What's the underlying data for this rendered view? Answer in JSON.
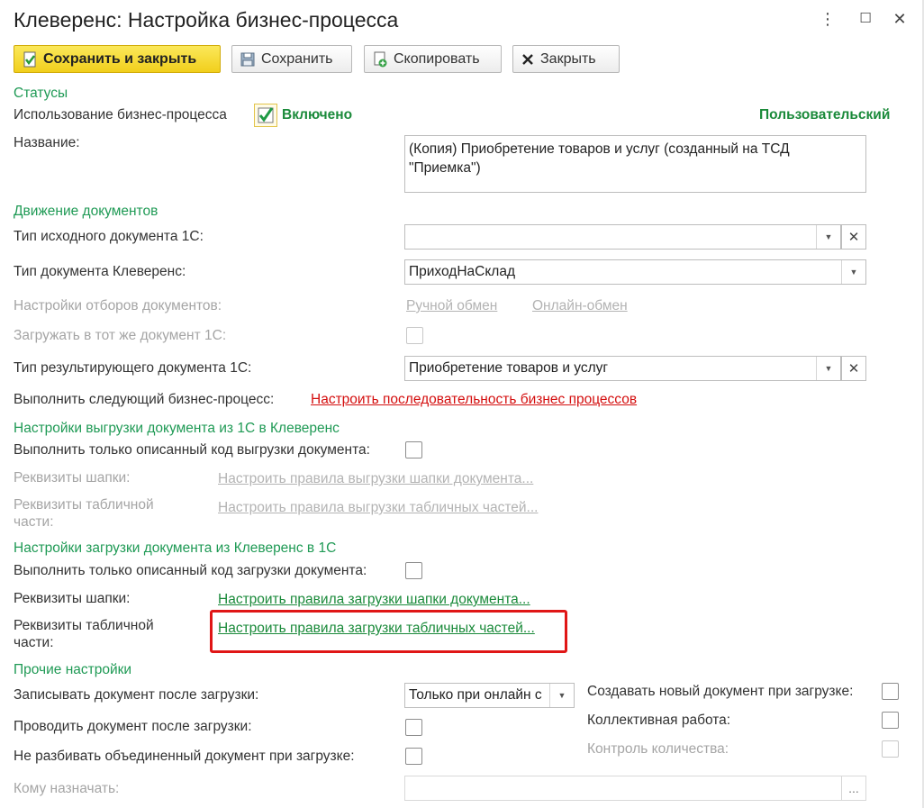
{
  "window": {
    "title": "Клеверенс: Настройка бизнес-процесса",
    "menu_glyph": "⋮",
    "maximize_glyph": "☐",
    "close_glyph": "✕"
  },
  "toolbar": {
    "save_close": "Сохранить и закрыть",
    "save": "Сохранить",
    "copy": "Скопировать",
    "close": "Закрыть"
  },
  "statuses": {
    "section": "Статусы",
    "usage_label": "Использование бизнес-процесса",
    "usage_checked": true,
    "usage_state": "Включено",
    "custom_badge": "Пользовательский",
    "name_label": "Название:",
    "name_value": "(Копия) Приобретение товаров и услуг (созданный на ТСД \"Приемка\")"
  },
  "movement": {
    "section": "Движение документов",
    "source_type_label": "Тип исходного документа 1С:",
    "source_type_value": "",
    "cleverence_type_label": "Тип документа Клеверенс:",
    "cleverence_type_value": "ПриходНаСклад",
    "filters_label": "Настройки отборов документов:",
    "manual_exchange": "Ручной обмен",
    "online_exchange": "Онлайн-обмен",
    "load_same_label": "Загружать в тот же документ 1С:",
    "result_type_label": "Тип результирующего документа 1С:",
    "result_type_value": "Приобретение товаров и услуг",
    "next_process_label": "Выполнить следующий бизнес-процесс:",
    "next_process_link": "Настроить последовательность бизнес процессов"
  },
  "export": {
    "section": "Настройки выгрузки документа из 1С в Клеверенс",
    "only_code_label": "Выполнить только описанный код выгрузки документа:",
    "header_label": "Реквизиты шапки:",
    "header_link": "Настроить правила выгрузки шапки документа...",
    "table_label_1": "Реквизиты табличной",
    "table_label_2": "части:",
    "table_link": "Настроить правила выгрузки табличных частей..."
  },
  "import": {
    "section": "Настройки загрузки документа из Клеверенс в 1С",
    "only_code_label": "Выполнить только описанный код загрузки документа:",
    "header_label": "Реквизиты шапки:",
    "header_link": "Настроить правила загрузки шапки документа...",
    "table_label_1": "Реквизиты табличной",
    "table_label_2": "части:",
    "table_link": "Настроить правила загрузки табличных частей..."
  },
  "other": {
    "section": "Прочие настройки",
    "write_after_label": "Записывать документ после загрузки:",
    "write_after_value": "Только при онлайн с",
    "post_after_label": "Проводить документ после загрузки:",
    "no_split_label": "Не разбивать объединенный документ при загрузке:",
    "assign_to_label": "Кому назначать:",
    "assign_to_value": "",
    "assign_to_btn": "...",
    "create_new_label": "Создавать новый документ при загрузке:",
    "collective_label": "Коллективная работа:",
    "quantity_control_label": "Контроль количества:"
  },
  "colors": {
    "section": "#1f9a55",
    "accent_yellow": "#f1cf1c",
    "highlight": "#e01616",
    "link_red": "#d40f0f",
    "link_green": "#1a8a3a"
  }
}
